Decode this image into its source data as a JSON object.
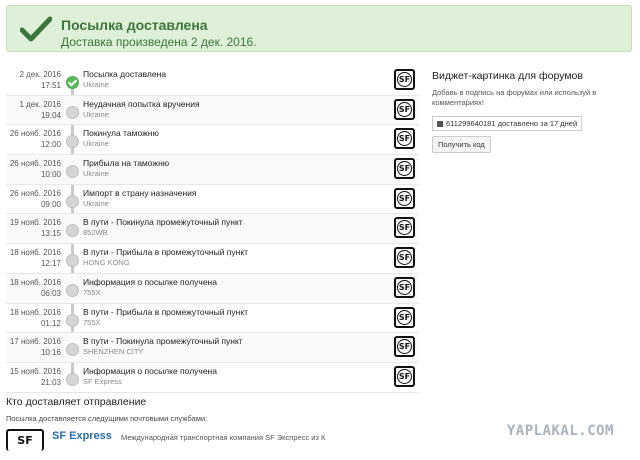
{
  "banner": {
    "title": "Посылка доставлена",
    "subtitle": "Доставка произведена 2 дек. 2016."
  },
  "events": [
    {
      "date": "2 дек. 2016",
      "time": "17:51",
      "status": "Посылка доставлена",
      "location": "Ukraine",
      "active": true
    },
    {
      "date": "1 дек. 2016",
      "time": "19:04",
      "status": "Неудачная попытка вручения",
      "location": "Ukraine",
      "active": false
    },
    {
      "date": "26 нояб. 2016",
      "time": "12:00",
      "status": "Покинула таможню",
      "location": "Ukraine",
      "active": false
    },
    {
      "date": "26 нояб. 2016",
      "time": "10:00",
      "status": "Прибыла на таможню",
      "location": "Ukraine",
      "active": false
    },
    {
      "date": "26 нояб. 2016",
      "time": "09:00",
      "status": "Импорт в страну назначения",
      "location": "Ukraine",
      "active": false
    },
    {
      "date": "19 нояб. 2016",
      "time": "13:15",
      "status": "В пути - Покинула промежуточный пункт",
      "location": "852WB",
      "active": false
    },
    {
      "date": "18 нояб. 2016",
      "time": "12:17",
      "status": "В пути - Прибыла в промежуточный пункт",
      "location": "HONG KONG",
      "active": false
    },
    {
      "date": "18 нояб. 2016",
      "time": "06:03",
      "status": "Информация о посылке получена",
      "location": "755X",
      "active": false
    },
    {
      "date": "18 нояб. 2016",
      "time": "01:12",
      "status": "В пути - Прибыла в промежуточный пункт",
      "location": "755X",
      "active": false
    },
    {
      "date": "17 нояб. 2016",
      "time": "10:16",
      "status": "В пути - Покинула промежуточный пункт",
      "location": "SHENZHEN CITY",
      "active": false
    },
    {
      "date": "15 нояб. 2016",
      "time": "21:03",
      "status": "Информация о посылке получена",
      "location": "SF Express",
      "active": false
    }
  ],
  "carrier_icon_text": "SF",
  "widget": {
    "title": "Виджет-картинка для форумов",
    "description": "Добавь в подпись на форумах или используй в комментариях!",
    "badge_text": "611299640181 доставлено за 17 дней",
    "button_label": "Получить код"
  },
  "carrier_section": {
    "heading": "Кто доставляет отправление",
    "subheading": "Посылка доставляется следущими почтовыми службами:",
    "logo_text": "SF",
    "name": "SF Express",
    "description": "Международная транспортная компания SF Экспресс из К"
  },
  "watermark": "YAPLAKAL.COM",
  "colors": {
    "success_bg": "#dff0d8",
    "success_text": "#3c763d",
    "success_check": "#5cb85c",
    "link_blue": "#2a6db0"
  }
}
